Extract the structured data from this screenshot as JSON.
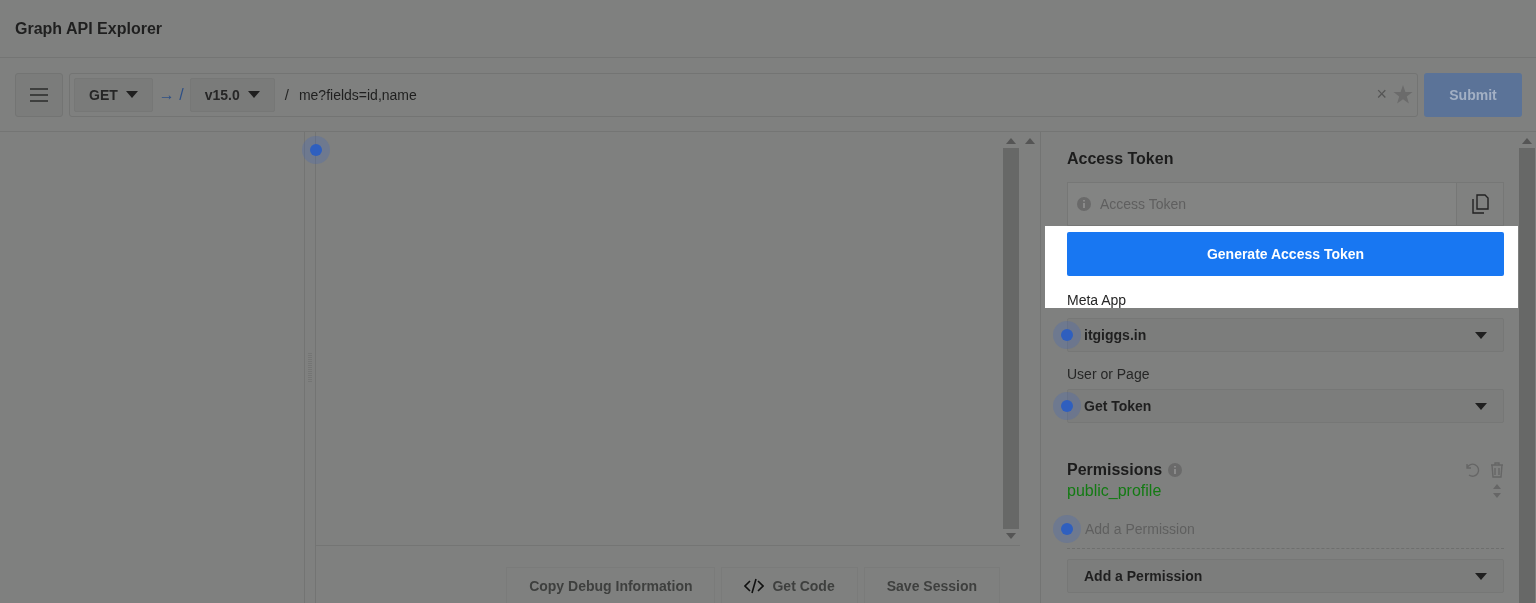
{
  "app_title": "Graph API Explorer",
  "toolbar": {
    "method": "GET",
    "arrow": "→ /",
    "version": "v15.0",
    "separator": "/",
    "path": "me?fields=id,name",
    "clear": "×",
    "submit": "Submit"
  },
  "editor_actions": [
    {
      "label": "Copy Debug Information",
      "kind": "text"
    },
    {
      "label": "Get Code",
      "kind": "code"
    },
    {
      "label": "Save Session",
      "kind": "text"
    }
  ],
  "access_token": {
    "heading": "Access Token",
    "placeholder": "Access Token",
    "generate": "Generate Access Token",
    "highlighted": true
  },
  "meta_app": {
    "label": "Meta App",
    "value": "itgiggs.in"
  },
  "user_or_page": {
    "label": "User or Page",
    "value": "Get Token"
  },
  "permissions": {
    "heading": "Permissions",
    "items": [
      "public_profile"
    ],
    "add_placeholder": "Add a Permission",
    "add_dropdown": "Add a Permission"
  }
}
